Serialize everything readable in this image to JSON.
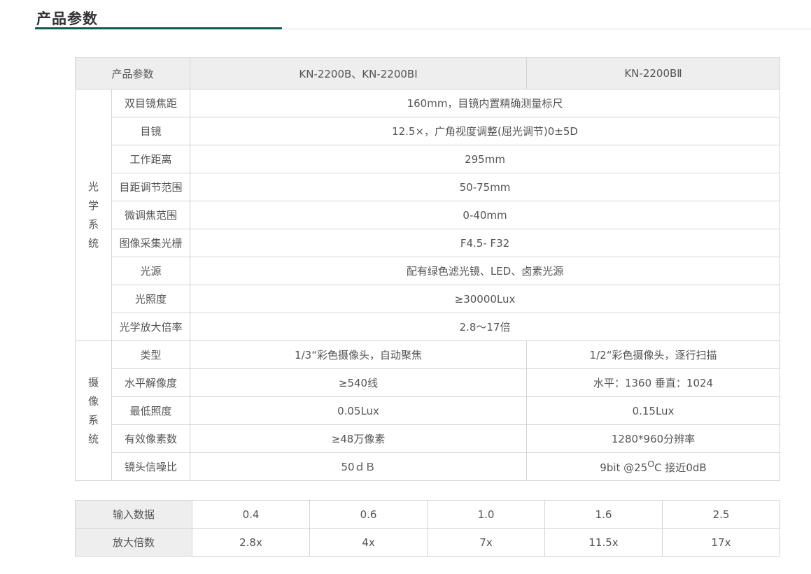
{
  "section": {
    "title": "产品参数"
  },
  "params": {
    "header": {
      "label": "产品参数",
      "model_a": "KN-2200B、KN-2200BⅠ",
      "model_b": "KN-2200BⅡ"
    },
    "optical": {
      "group": [
        "光",
        "学",
        "系",
        "统"
      ],
      "rows": [
        {
          "label": "双目镜焦距",
          "value": "160mm，目镜内置精确测量标尺"
        },
        {
          "label": "目镜",
          "value": "12.5×，广角视度调整(屈光调节)0±5D"
        },
        {
          "label": "工作距离",
          "value": "295mm"
        },
        {
          "label": "目距调节范围",
          "value": "50-75mm"
        },
        {
          "label": "微调焦范围",
          "value": "0-40mm"
        },
        {
          "label": "图像采集光栅",
          "value": "F4.5- F32"
        },
        {
          "label": "光源",
          "value": "配有绿色滤光镜、LED、卤素光源"
        },
        {
          "label": "光照度",
          "value": "≥30000Lux"
        },
        {
          "label": "光学放大倍率",
          "value": "2.8～17倍"
        }
      ]
    },
    "camera": {
      "group": [
        "摄",
        "像",
        "系",
        "统"
      ],
      "rows": [
        {
          "label": "类型",
          "a": "1/3“彩色摄像头，自动聚焦",
          "b": "1/2“彩色摄像头，逐行扫描"
        },
        {
          "label": "水平解像度",
          "a": "≥540线",
          "b": "水平：1360 垂直：1024"
        },
        {
          "label": "最低照度",
          "a": "0.05Lux",
          "b": "0.15Lux"
        },
        {
          "label": "有效像素数",
          "a": "≥48万像素",
          "b": "1280*960分辨率"
        },
        {
          "label": "镜头信噪比",
          "a": "50ｄＢ",
          "b_prefix": "9bit @25",
          "b_sup": "O",
          "b_suffix": "C 接近0dB"
        }
      ]
    }
  },
  "magnification": {
    "input_label": "输入数据",
    "output_label": "放大倍数",
    "inputs": [
      "0.4",
      "0.6",
      "1.0",
      "1.6",
      "2.5"
    ],
    "outputs": [
      "2.8x",
      "4x",
      "7x",
      "11.5x",
      "17x"
    ]
  }
}
